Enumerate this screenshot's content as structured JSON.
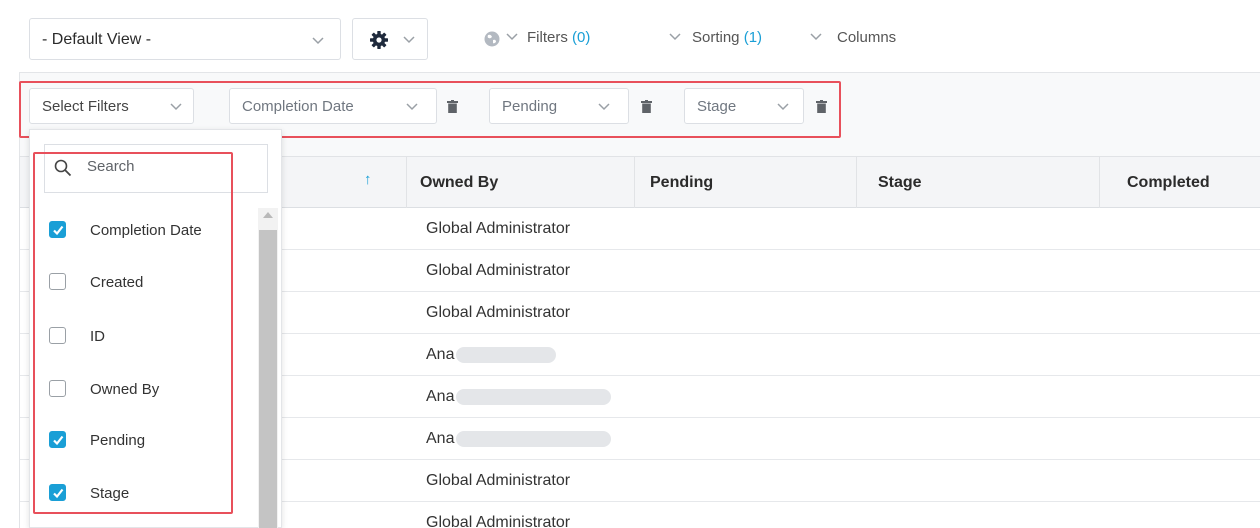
{
  "toolbar": {
    "view_select": "- Default View -",
    "filters_label": "Filters",
    "filters_count": "(0)",
    "sorting_label": "Sorting",
    "sorting_count": "(1)",
    "columns_label": "Columns"
  },
  "filter_bar": {
    "select_filters": "Select Filters",
    "active_filters": [
      "Completion Date",
      "Pending",
      "Stage"
    ]
  },
  "table": {
    "sort_indicator": "↑",
    "columns": [
      "Owned By",
      "Pending",
      "Stage",
      "Completed"
    ],
    "rows": [
      {
        "owner": "Global Administrator",
        "redacted": false
      },
      {
        "owner": "Global Administrator",
        "redacted": false
      },
      {
        "owner": "Global Administrator",
        "redacted": false
      },
      {
        "owner": "Ana",
        "redacted": true
      },
      {
        "owner": "Ana",
        "redacted": true
      },
      {
        "owner": "Ana",
        "redacted": true
      },
      {
        "owner": "Global Administrator",
        "redacted": false
      },
      {
        "owner": "Global Administrator",
        "redacted": false
      }
    ]
  },
  "dropdown": {
    "search_placeholder": "Search",
    "options": [
      {
        "label": "Completion Date",
        "checked": true
      },
      {
        "label": "Created",
        "checked": false
      },
      {
        "label": "ID",
        "checked": false
      },
      {
        "label": "Owned By",
        "checked": false
      },
      {
        "label": "Pending",
        "checked": true
      },
      {
        "label": "Stage",
        "checked": true
      }
    ]
  },
  "colors": {
    "accent": "#1a9fd6",
    "highlight": "#e8505b"
  }
}
